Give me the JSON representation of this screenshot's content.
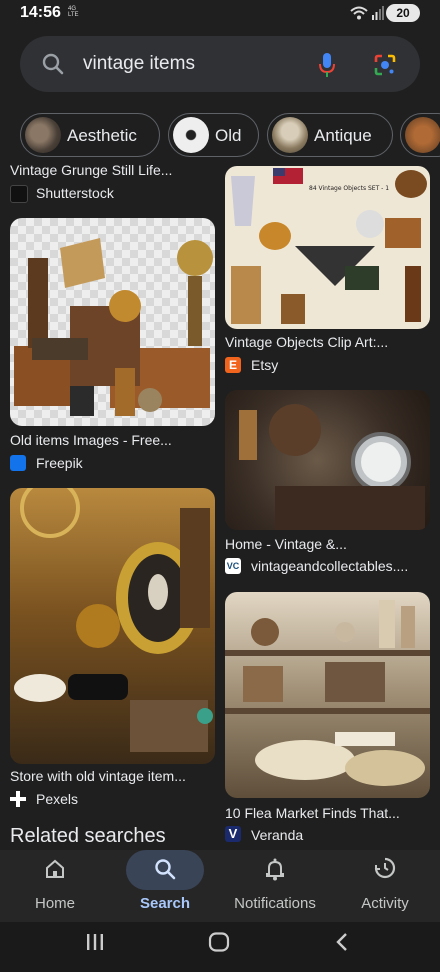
{
  "status": {
    "time": "14:56",
    "network": "4G LTE",
    "battery": "20"
  },
  "search": {
    "query": "vintage items"
  },
  "chips": [
    {
      "label": "Aesthetic"
    },
    {
      "label": "Old"
    },
    {
      "label": "Antique"
    }
  ],
  "results": {
    "left": [
      {
        "title": "Vintage Grunge Still Life...",
        "source": "Shutterstock"
      },
      {
        "title": "Old items Images - Free...",
        "source": "Freepik"
      },
      {
        "title": "Store with old vintage item...",
        "source": "Pexels"
      }
    ],
    "right": [
      {
        "title": "Vintage Objects Clip Art:...",
        "source": "Etsy",
        "image_text": "84 Vintage Objects SET - 1"
      },
      {
        "title": "Home - Vintage &...",
        "source": "vintageandcollectables...."
      },
      {
        "title": "10 Flea Market Finds That...",
        "source": "Veranda"
      }
    ]
  },
  "related": "Related searches",
  "nav": [
    {
      "label": "Home"
    },
    {
      "label": "Search"
    },
    {
      "label": "Notifications"
    },
    {
      "label": "Activity"
    }
  ],
  "colors": {
    "accent": "#8ab4f8",
    "pill": "#394457",
    "etsy": "#f1641e",
    "freepik": "#1273eb"
  }
}
